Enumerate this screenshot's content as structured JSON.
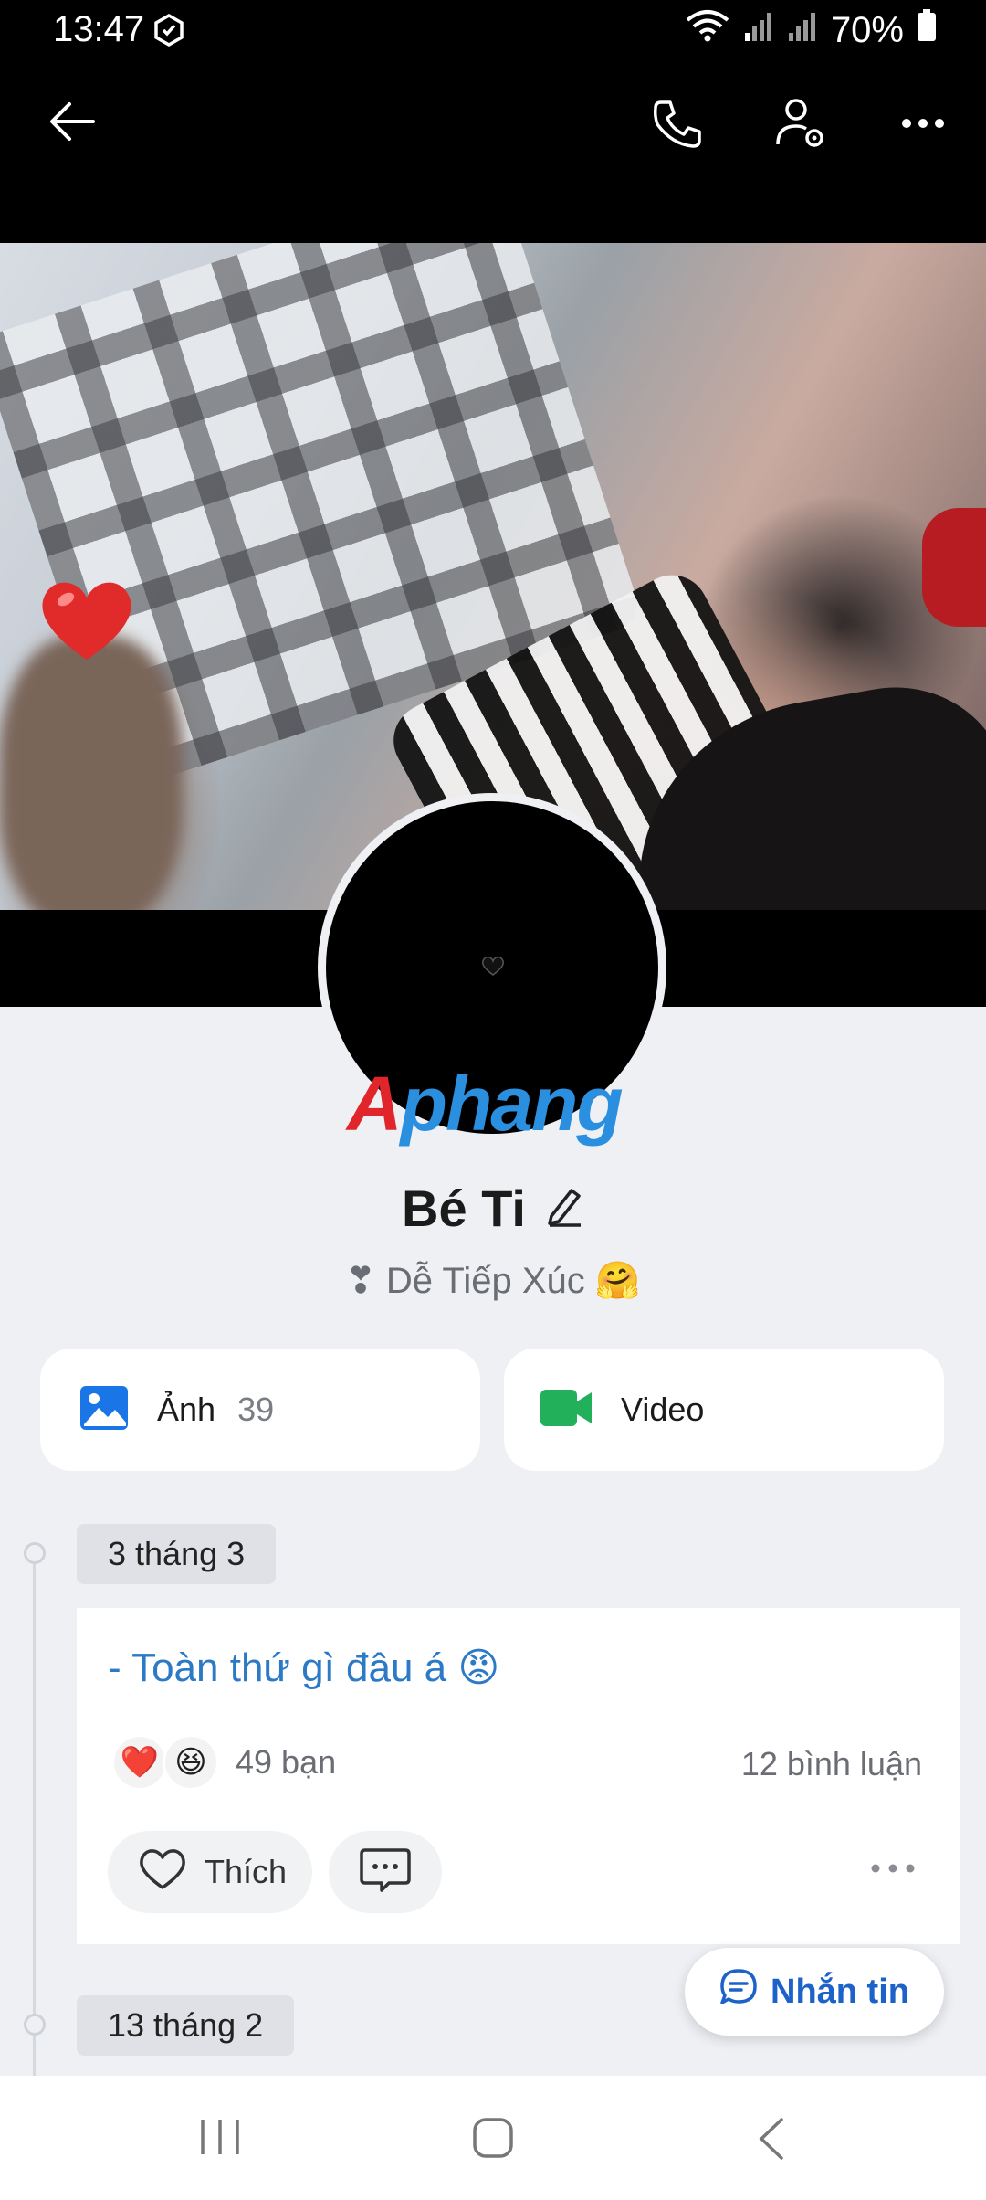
{
  "status_bar": {
    "time": "13:47",
    "battery": "70%"
  },
  "profile": {
    "name": "Bé Ti",
    "status": "❣ Dễ Tiếp Xúc 🤗",
    "watermark_a": "A",
    "watermark_b": "phang"
  },
  "media": {
    "photos_label": "Ảnh",
    "photos_count": "39",
    "video_label": "Video"
  },
  "timeline": {
    "entries": [
      {
        "date": "3 tháng 3",
        "text": "- Toàn thứ gì đâu á 😡",
        "reactions": [
          "❤️",
          "😆"
        ],
        "reaction_count": "49 bạn",
        "comment_count": "12 bình luận",
        "like_label": "Thích"
      },
      {
        "date": "13 tháng 2"
      }
    ]
  },
  "floating": {
    "message_label": "Nhắn tin"
  },
  "icons": [
    "back-arrow-icon",
    "phone-icon",
    "user-settings-icon",
    "more-icon",
    "edit-pencil-icon",
    "image-icon",
    "video-camera-icon",
    "heart-outline-icon",
    "comment-icon",
    "chat-bubble-icon"
  ],
  "colors": {
    "accent": "#1c62c9",
    "post_text": "#2c7ac6",
    "video_green": "#22b05a",
    "photo_blue": "#1a76e6"
  }
}
